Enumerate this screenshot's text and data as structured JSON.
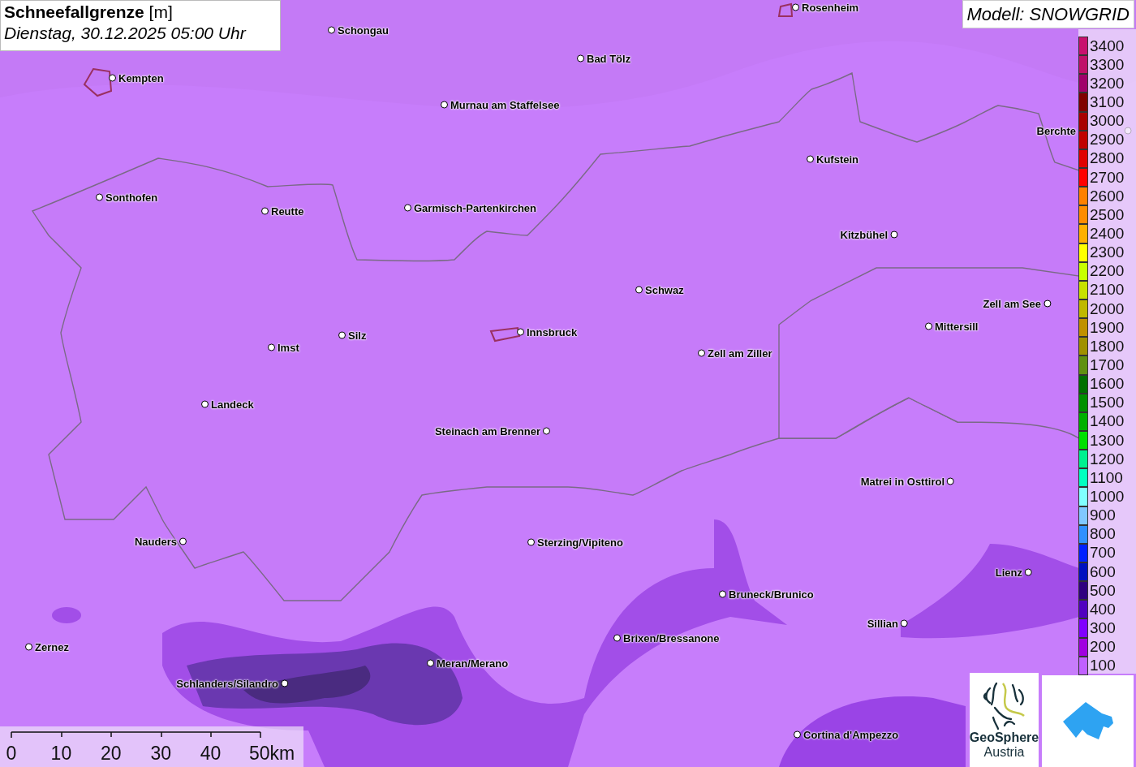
{
  "title": {
    "variable": "Schneefallgrenze",
    "unit": "[m]",
    "time": "Dienstag, 30.12.2025 05:00 Uhr"
  },
  "model_label": "Modell: SNOWGRID",
  "cities": [
    {
      "name": "Rosenheim"
    },
    {
      "name": "Schongau"
    },
    {
      "name": "Bad Tölz"
    },
    {
      "name": "Kempten"
    },
    {
      "name": "Murnau am Staffelsee"
    },
    {
      "name": "Berchte"
    },
    {
      "name": "Kufstein"
    },
    {
      "name": "Sonthofen"
    },
    {
      "name": "Reutte"
    },
    {
      "name": "Garmisch-Partenkirchen"
    },
    {
      "name": "Kitzbühel"
    },
    {
      "name": "Schwaz"
    },
    {
      "name": "Zell am See"
    },
    {
      "name": "Mittersill"
    },
    {
      "name": "Innsbruck"
    },
    {
      "name": "Silz"
    },
    {
      "name": "Imst"
    },
    {
      "name": "Zell am Ziller"
    },
    {
      "name": "Landeck"
    },
    {
      "name": "Steinach am Brenner"
    },
    {
      "name": "Matrei in Osttirol"
    },
    {
      "name": "Nauders"
    },
    {
      "name": "Sterzing/Vipiteno"
    },
    {
      "name": "Lienz"
    },
    {
      "name": "Bruneck/Brunico"
    },
    {
      "name": "Sillian"
    },
    {
      "name": "Brixen/Bressanone"
    },
    {
      "name": "Zernez"
    },
    {
      "name": "Meran/Merano"
    },
    {
      "name": "Schlanders/Silandro"
    },
    {
      "name": "Cortina d'Ampezzo"
    }
  ],
  "legend": [
    {
      "label": "3400",
      "color": "#c8106e"
    },
    {
      "label": "3300",
      "color": "#c0106a"
    },
    {
      "label": "3200",
      "color": "#a0006a"
    },
    {
      "label": "3100",
      "color": "#800000"
    },
    {
      "label": "3000",
      "color": "#a80000"
    },
    {
      "label": "2900",
      "color": "#c00000"
    },
    {
      "label": "2800",
      "color": "#e00000"
    },
    {
      "label": "2700",
      "color": "#ff0000"
    },
    {
      "label": "2600",
      "color": "#ff8000"
    },
    {
      "label": "2500",
      "color": "#ff8c00"
    },
    {
      "label": "2400",
      "color": "#ffb000"
    },
    {
      "label": "2300",
      "color": "#ffff00"
    },
    {
      "label": "2200",
      "color": "#c8ff00"
    },
    {
      "label": "2100",
      "color": "#c8e000"
    },
    {
      "label": "2000",
      "color": "#c0b800"
    },
    {
      "label": "1900",
      "color": "#c09000"
    },
    {
      "label": "1800",
      "color": "#a09000"
    },
    {
      "label": "1700",
      "color": "#609010"
    },
    {
      "label": "1600",
      "color": "#007000"
    },
    {
      "label": "1500",
      "color": "#009000"
    },
    {
      "label": "1400",
      "color": "#00b000"
    },
    {
      "label": "1300",
      "color": "#00e000"
    },
    {
      "label": "1200",
      "color": "#00f090"
    },
    {
      "label": "1100",
      "color": "#00ffc0"
    },
    {
      "label": "1000",
      "color": "#80ffff"
    },
    {
      "label": "900",
      "color": "#80c8ff"
    },
    {
      "label": "800",
      "color": "#3090ff"
    },
    {
      "label": "700",
      "color": "#0020ff"
    },
    {
      "label": "600",
      "color": "#0010c0"
    },
    {
      "label": "500",
      "color": "#300080"
    },
    {
      "label": "400",
      "color": "#5000c0"
    },
    {
      "label": "300",
      "color": "#8000ff"
    },
    {
      "label": "200",
      "color": "#a000e0"
    },
    {
      "label": "100",
      "color": "#c060ff"
    }
  ],
  "scale_bar": {
    "labels": [
      "0",
      "10",
      "20",
      "30",
      "40",
      "50km"
    ]
  },
  "logo": {
    "line1": "GeoSphere",
    "line2": "Austria"
  }
}
